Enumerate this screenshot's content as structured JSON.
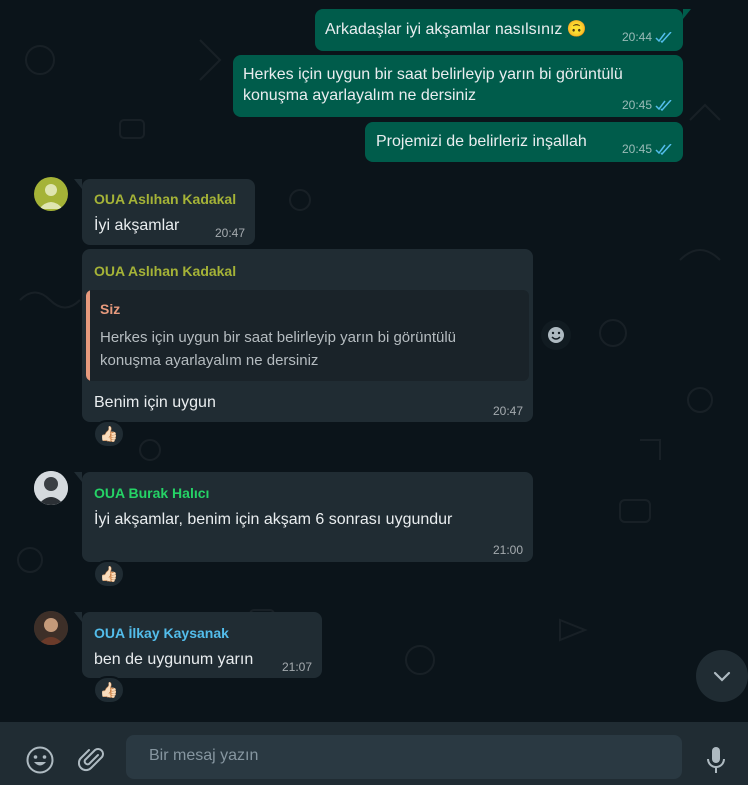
{
  "colors": {
    "background": "#0b141a",
    "outgoing_bubble": "#005c4b",
    "incoming_bubble": "#202c33",
    "read_ticks": "#53bdeb",
    "sender_aslihan": "#a5b337",
    "sender_burak": "#25d366",
    "sender_ilkay": "#53bdeb",
    "quote_accent": "#e79a7d"
  },
  "messages_out": [
    {
      "text": "Arkadaşlar iyi akşamlar nasılsınız 🙃",
      "time": "20:44"
    },
    {
      "text": "Herkes için uygun bir saat belirleyip yarın bi görüntülü konuşma ayarlayalım ne dersiniz",
      "time": "20:45"
    },
    {
      "text": "Projemizi de belirleriz inşallah",
      "time": "20:45"
    }
  ],
  "messages_in": [
    {
      "sender": "OUA Aslıhan Kadakal",
      "text": "İyi akşamlar",
      "time": "20:47"
    },
    {
      "sender": "OUA Aslıhan Kadakal",
      "quote_author": "Siz",
      "quote_text": "Herkes için uygun bir saat belirleyip yarın bi görüntülü konuşma ayarlayalım ne dersiniz",
      "text": "Benim için uygun",
      "time": "20:47",
      "reaction": "👍🏻"
    },
    {
      "sender": "OUA Burak Halıcı",
      "text": "İyi akşamlar,  benim için akşam 6 sonrası uygundur",
      "time": "21:00",
      "reaction": "👍🏻"
    },
    {
      "sender": "OUA İlkay Kaysanak",
      "text": "ben de uygunum yarın",
      "time": "21:07",
      "reaction": "👍🏻"
    }
  ],
  "composer": {
    "placeholder": "Bir mesaj yazın",
    "emoji_icon": "emoji-icon",
    "attach_icon": "paperclip-icon",
    "mic_icon": "microphone-icon"
  }
}
